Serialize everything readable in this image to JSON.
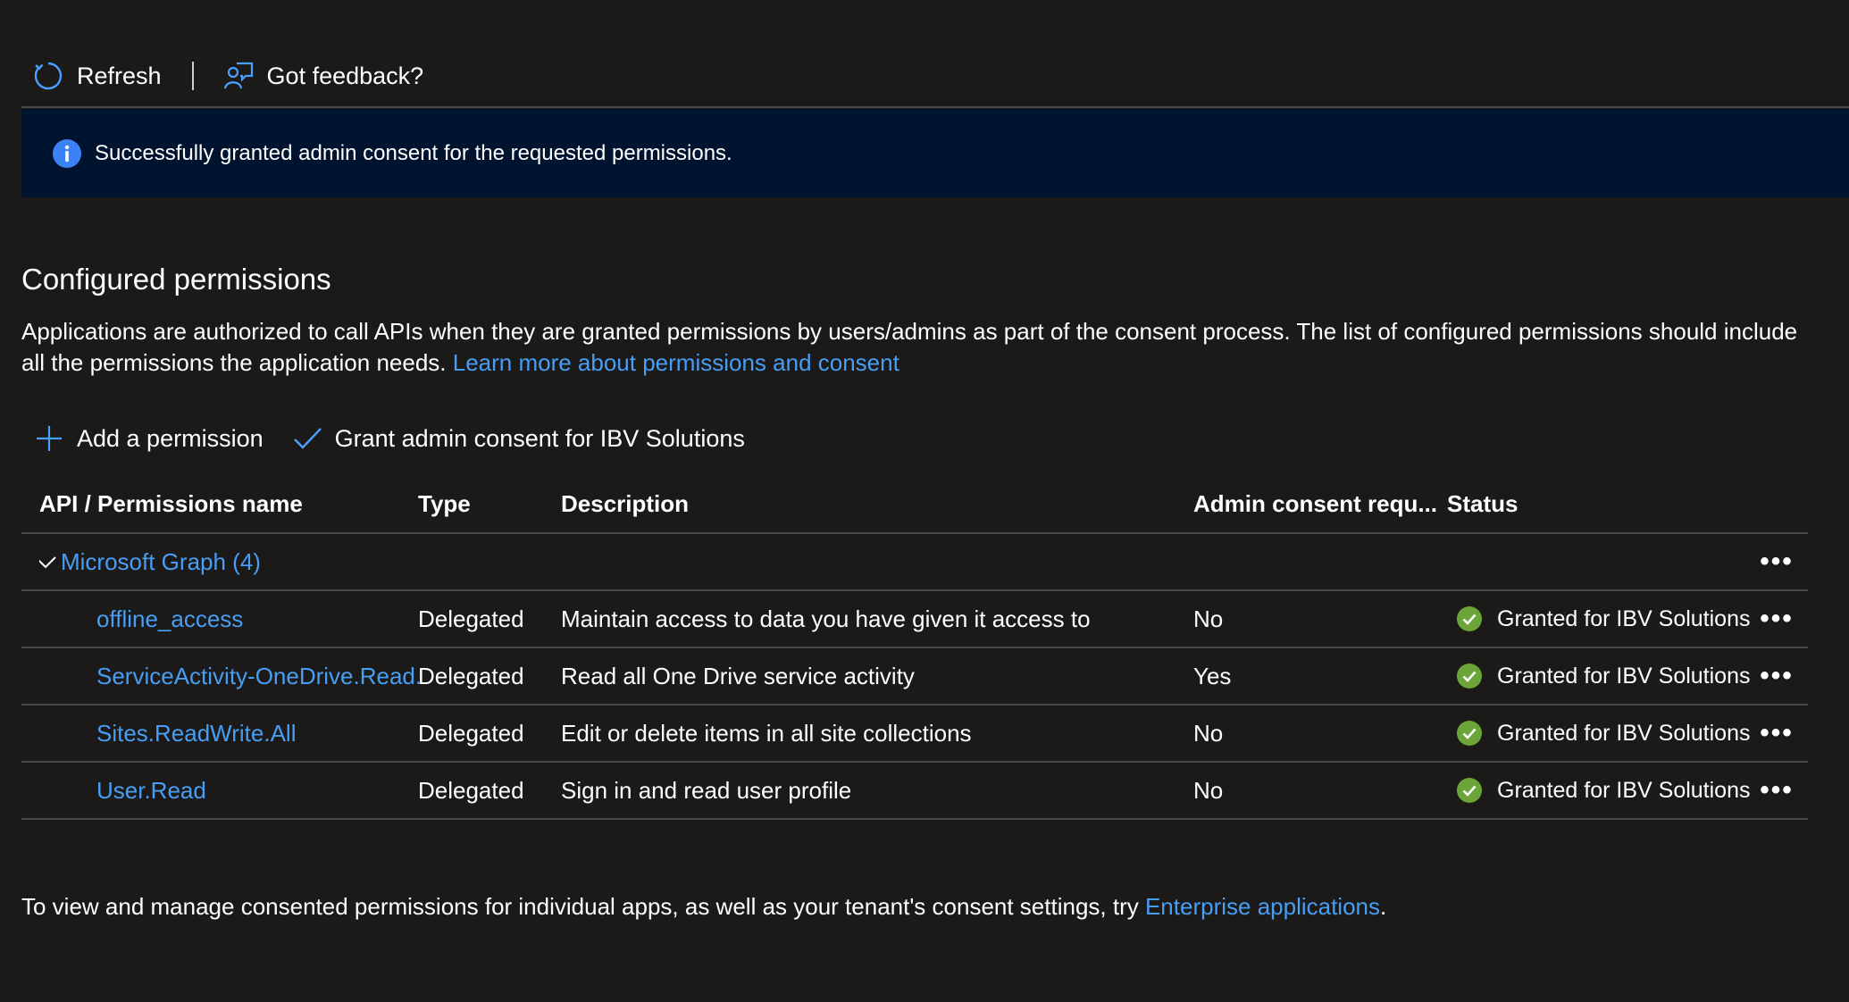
{
  "toolbar": {
    "refresh_label": "Refresh",
    "feedback_label": "Got feedback?"
  },
  "banner": {
    "icon": "info-icon",
    "message": "Successfully granted admin consent for the requested permissions."
  },
  "section": {
    "title": "Configured permissions",
    "description": "Applications are authorized to call APIs when they are granted permissions by users/admins as part of the consent process. The list of configured permissions should include all the permissions the application needs.",
    "learn_more_link": "Learn more about permissions and consent"
  },
  "commands": {
    "add_permission": "Add a permission",
    "grant_consent": "Grant admin consent for IBV Solutions"
  },
  "table": {
    "columns": {
      "name": "API / Permissions name",
      "type": "Type",
      "description": "Description",
      "admin_consent": "Admin consent requ...",
      "status": "Status"
    },
    "group": {
      "label": "Microsoft Graph (4)"
    },
    "rows": [
      {
        "name": "offline_access",
        "type": "Delegated",
        "description": "Maintain access to data you have given it access to",
        "admin_consent": "No",
        "status": "Granted for IBV Solutions"
      },
      {
        "name": "ServiceActivity-OneDrive.Read.A",
        "type": "Delegated",
        "description": "Read all One Drive service activity",
        "admin_consent": "Yes",
        "status": "Granted for IBV Solutions"
      },
      {
        "name": "Sites.ReadWrite.All",
        "type": "Delegated",
        "description": "Edit or delete items in all site collections",
        "admin_consent": "No",
        "status": "Granted for IBV Solutions"
      },
      {
        "name": "User.Read",
        "type": "Delegated",
        "description": "Sign in and read user profile",
        "admin_consent": "No",
        "status": "Granted for IBV Solutions"
      }
    ],
    "more_glyph": "•••"
  },
  "footer": {
    "text_before": "To view and manage consented permissions for individual apps, as well as your tenant's consent settings, try ",
    "link": "Enterprise applications",
    "text_after": "."
  },
  "colors": {
    "background": "#1b1a19",
    "banner": "#00142f",
    "link": "#479ef5",
    "success": "#6ba539",
    "info": "#3b82f6"
  }
}
